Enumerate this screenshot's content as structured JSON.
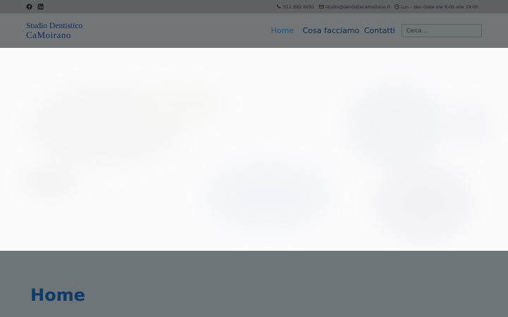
{
  "topbar": {
    "social": [
      "facebook-icon",
      "linkedin-icon"
    ],
    "phone": "011 682 8091",
    "email": "studio@dentistacamoirano.it",
    "hours": "Lun - Ven dalle ore 9:00 alle 19:00"
  },
  "header": {
    "logo_line1": "Studio Dentistico",
    "logo_line2": "CaMoirano"
  },
  "nav": {
    "items": [
      {
        "label": "Home",
        "active": true
      },
      {
        "label": "Cosa facciamo",
        "active": false
      },
      {
        "label": "Contatti",
        "active": false
      }
    ]
  },
  "search": {
    "placeholder": "Cerca ..."
  },
  "main": {
    "page_title": "Home"
  },
  "colors": {
    "topbar_bg": "#5f6163",
    "header_bg": "#727678",
    "nav_active": "#1d4e80",
    "nav_text": "#0b2a4b",
    "title": "#0e3a68",
    "hero_bg": "#fbfbfc"
  }
}
